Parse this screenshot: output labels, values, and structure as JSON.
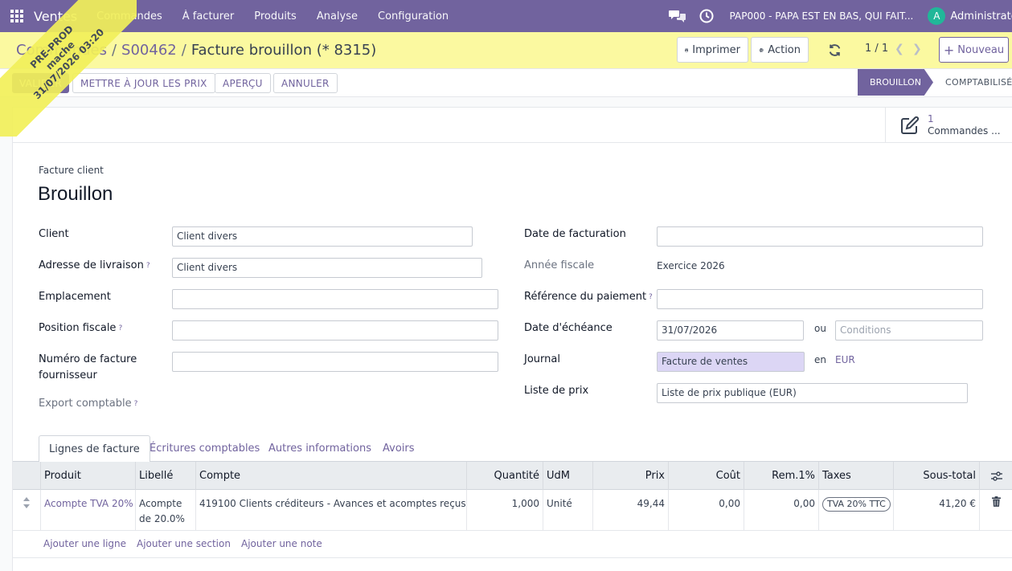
{
  "navbar": {
    "app_name": "Ventes",
    "menu": [
      "Commandes",
      "À facturer",
      "Produits",
      "Analyse",
      "Configuration"
    ],
    "company": "PAP000 - PAPA EST EN BAS, QUI FAIT...",
    "avatar_letter": "A",
    "user": "Administrator"
  },
  "breadcrumb": {
    "parent": "Commandes",
    "order": "S00462",
    "current": "Facture brouillon (* 8315)"
  },
  "controlpanel": {
    "print_label": "Imprimer",
    "action_label": "Action",
    "pager": "1 / 1",
    "new_label": "Nouveau"
  },
  "statusbar": {
    "buttons": [
      "VALIDER",
      "METTRE À JOUR LES PRIX",
      "APERÇU",
      "ANNULER"
    ],
    "stages": [
      "BROUILLON",
      "COMPTABILISÉ"
    ]
  },
  "smart_button": {
    "count": "1",
    "label": "Commandes ..."
  },
  "document": {
    "type": "Facture client",
    "title": "Brouillon"
  },
  "fields_left": {
    "client": {
      "label": "Client",
      "value": "Client divers"
    },
    "delivery": {
      "label": "Adresse de livraison",
      "value": "Client divers"
    },
    "location": {
      "label": "Emplacement",
      "value": ""
    },
    "fiscal_position": {
      "label": "Position fiscale",
      "value": ""
    },
    "supplier_invoice": {
      "label_1": "Numéro de facture",
      "label_2": "fournisseur",
      "value": ""
    },
    "export": {
      "label": "Export comptable"
    }
  },
  "fields_right": {
    "invoice_date": {
      "label": "Date de facturation",
      "value": ""
    },
    "fiscal_year": {
      "label": "Année fiscale",
      "value": "Exercice 2026"
    },
    "payment_ref": {
      "label": "Référence du paiement",
      "value": ""
    },
    "due_date": {
      "label": "Date d'échéance",
      "value": "31/07/2026",
      "or": "ou",
      "terms_placeholder": "Conditions"
    },
    "journal": {
      "label": "Journal",
      "value": "Facture de ventes",
      "in": "en",
      "currency": "EUR"
    },
    "pricelist": {
      "label": "Liste de prix",
      "value": "Liste de prix publique (EUR)"
    }
  },
  "tabs": [
    "Lignes de facture",
    "Écritures comptables",
    "Autres informations",
    "Avoirs"
  ],
  "lines_table": {
    "columns": [
      "Produit",
      "Libellé",
      "Compte",
      "Quantité",
      "UdM",
      "Prix",
      "Coût",
      "Rem.1%",
      "Taxes",
      "Sous-total"
    ],
    "rows": [
      {
        "product": "Acompte TVA 20%",
        "label_1": "Acompte",
        "label_2": "de 20.0%",
        "account": "419100 Clients créditeurs - Avances et acomptes reçus...",
        "quantity": "1,000",
        "uom": "Unité",
        "price": "49,44",
        "cost": "0,00",
        "discount": "0,00",
        "tax": "TVA 20% TTC",
        "subtotal": "41,20 €"
      }
    ],
    "add_links": [
      "Ajouter une ligne",
      "Ajouter une section",
      "Ajouter une note"
    ]
  },
  "ribbon": {
    "line_1": "PRE-PROD",
    "line_2": "mache",
    "line_3": "31/07/2026 03:20"
  },
  "colors": {
    "primary": "#71639e",
    "ribbon": "#f2f05a",
    "control_panel": "#fbf9a0"
  }
}
